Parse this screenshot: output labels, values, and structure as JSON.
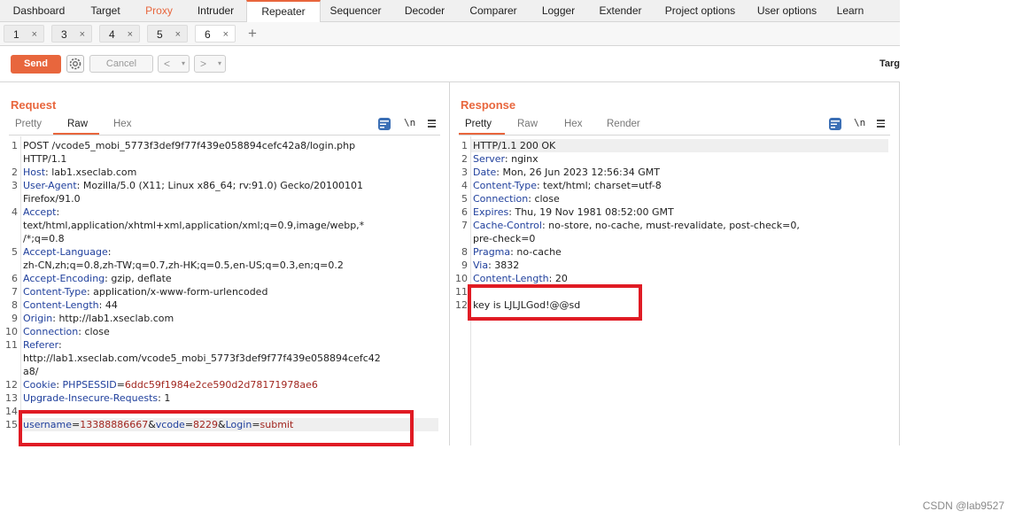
{
  "menu_tabs": [
    {
      "label": "Dashboard"
    },
    {
      "label": "Target"
    },
    {
      "label": "Proxy"
    },
    {
      "label": "Intruder"
    },
    {
      "label": "Repeater"
    },
    {
      "label": "Sequencer"
    },
    {
      "label": "Decoder"
    },
    {
      "label": "Comparer"
    },
    {
      "label": "Logger"
    },
    {
      "label": "Extender"
    },
    {
      "label": "Project options"
    },
    {
      "label": "User options"
    },
    {
      "label": "Learn"
    }
  ],
  "active_menu_tab": "Repeater",
  "repeater_tabs": [
    {
      "label": "1"
    },
    {
      "label": "3"
    },
    {
      "label": "4"
    },
    {
      "label": "5"
    },
    {
      "label": "6"
    }
  ],
  "active_repeater_tab": "6",
  "tab_close": "×",
  "add_tab": "+",
  "toolbar": {
    "send_label": "Send",
    "cancel_label": "Cancel",
    "back": "<",
    "forward": ">",
    "dropdown": "▾",
    "target_label": "Targ"
  },
  "colors": {
    "accent": "#e8663d",
    "keyword": "#1f3f9c",
    "value": "#a1261f",
    "annotation": "#e01b24",
    "selected": "#3b6fb5"
  },
  "request": {
    "title": "Request",
    "views": [
      "Pretty",
      "Raw",
      "Hex"
    ],
    "active_view": "Raw",
    "newline_toggle": "\\n",
    "lines": [
      {
        "n": "1",
        "segments": [
          {
            "t": "POST /vcode5_mobi_5773f3def9f77f439e058894cefc42a8/login.php",
            "c": "plain"
          }
        ]
      },
      {
        "n": "",
        "segments": [
          {
            "t": "HTTP/1.1",
            "c": "plain"
          }
        ]
      },
      {
        "n": "2",
        "segments": [
          {
            "t": "Host",
            "c": "k"
          },
          {
            "t": ": lab1.xseclab.com",
            "c": "plain"
          }
        ]
      },
      {
        "n": "3",
        "segments": [
          {
            "t": "User-Agent",
            "c": "k"
          },
          {
            "t": ": Mozilla/5.0 (X11; Linux x86_64; rv:91.0) Gecko/20100101",
            "c": "plain"
          }
        ]
      },
      {
        "n": "",
        "segments": [
          {
            "t": "Firefox/91.0",
            "c": "plain"
          }
        ]
      },
      {
        "n": "4",
        "segments": [
          {
            "t": "Accept",
            "c": "k"
          },
          {
            "t": ":",
            "c": "plain"
          }
        ]
      },
      {
        "n": "",
        "segments": [
          {
            "t": "text/html,application/xhtml+xml,application/xml;q=0.9,image/webp,*",
            "c": "plain"
          }
        ]
      },
      {
        "n": "",
        "segments": [
          {
            "t": "/*;q=0.8",
            "c": "plain"
          }
        ]
      },
      {
        "n": "5",
        "segments": [
          {
            "t": "Accept-Language",
            "c": "k"
          },
          {
            "t": ":",
            "c": "plain"
          }
        ]
      },
      {
        "n": "",
        "segments": [
          {
            "t": "zh-CN,zh;q=0.8,zh-TW;q=0.7,zh-HK;q=0.5,en-US;q=0.3,en;q=0.2",
            "c": "plain"
          }
        ]
      },
      {
        "n": "6",
        "segments": [
          {
            "t": "Accept-Encoding",
            "c": "k"
          },
          {
            "t": ": gzip, deflate",
            "c": "plain"
          }
        ]
      },
      {
        "n": "7",
        "segments": [
          {
            "t": "Content-Type",
            "c": "k"
          },
          {
            "t": ": application/x-www-form-urlencoded",
            "c": "plain"
          }
        ]
      },
      {
        "n": "8",
        "segments": [
          {
            "t": "Content-Length",
            "c": "k"
          },
          {
            "t": ": 44",
            "c": "plain"
          }
        ]
      },
      {
        "n": "9",
        "segments": [
          {
            "t": "Origin",
            "c": "k"
          },
          {
            "t": ": http://lab1.xseclab.com",
            "c": "plain"
          }
        ]
      },
      {
        "n": "10",
        "segments": [
          {
            "t": "Connection",
            "c": "k"
          },
          {
            "t": ": close",
            "c": "plain"
          }
        ]
      },
      {
        "n": "11",
        "segments": [
          {
            "t": "Referer",
            "c": "k"
          },
          {
            "t": ":",
            "c": "plain"
          }
        ]
      },
      {
        "n": "",
        "segments": [
          {
            "t": "http://lab1.xseclab.com/vcode5_mobi_5773f3def9f77f439e058894cefc42",
            "c": "plain"
          }
        ]
      },
      {
        "n": "",
        "segments": [
          {
            "t": "a8/",
            "c": "plain"
          }
        ]
      },
      {
        "n": "12",
        "segments": [
          {
            "t": "Cookie",
            "c": "k"
          },
          {
            "t": ": ",
            "c": "plain"
          },
          {
            "t": "PHPSESSID",
            "c": "k"
          },
          {
            "t": "=",
            "c": "plain"
          },
          {
            "t": "6ddc59f1984e2ce590d2d78171978ae6",
            "c": "v"
          }
        ]
      },
      {
        "n": "13",
        "segments": [
          {
            "t": "Upgrade-Insecure-Requests",
            "c": "k"
          },
          {
            "t": ": 1",
            "c": "plain"
          }
        ]
      },
      {
        "n": "14",
        "segments": []
      },
      {
        "n": "15",
        "segments": [
          {
            "t": "username",
            "c": "k"
          },
          {
            "t": "=",
            "c": "plain"
          },
          {
            "t": "13388886667",
            "c": "v"
          },
          {
            "t": "&",
            "c": "plain"
          },
          {
            "t": "vcode",
            "c": "k"
          },
          {
            "t": "=",
            "c": "plain"
          },
          {
            "t": "8229",
            "c": "v"
          },
          {
            "t": "&",
            "c": "plain"
          },
          {
            "t": "Login",
            "c": "k"
          },
          {
            "t": "=",
            "c": "plain"
          },
          {
            "t": "submit",
            "c": "v"
          }
        ],
        "highlight": true
      }
    ]
  },
  "response": {
    "title": "Response",
    "views": [
      "Pretty",
      "Raw",
      "Hex",
      "Render"
    ],
    "active_view": "Pretty",
    "newline_toggle": "\\n",
    "lines": [
      {
        "n": "1",
        "segments": [
          {
            "t": "HTTP/1.1 200 OK",
            "c": "plain"
          }
        ],
        "highlight": true
      },
      {
        "n": "2",
        "segments": [
          {
            "t": "Server",
            "c": "k"
          },
          {
            "t": ": nginx",
            "c": "plain"
          }
        ]
      },
      {
        "n": "3",
        "segments": [
          {
            "t": "Date",
            "c": "k"
          },
          {
            "t": ": Mon, 26 Jun 2023 12:56:34 GMT",
            "c": "plain"
          }
        ]
      },
      {
        "n": "4",
        "segments": [
          {
            "t": "Content-Type",
            "c": "k"
          },
          {
            "t": ": text/html; charset=utf-8",
            "c": "plain"
          }
        ]
      },
      {
        "n": "5",
        "segments": [
          {
            "t": "Connection",
            "c": "k"
          },
          {
            "t": ": close",
            "c": "plain"
          }
        ]
      },
      {
        "n": "6",
        "segments": [
          {
            "t": "Expires",
            "c": "k"
          },
          {
            "t": ": Thu, 19 Nov 1981 08:52:00 GMT",
            "c": "plain"
          }
        ]
      },
      {
        "n": "7",
        "segments": [
          {
            "t": "Cache-Control",
            "c": "k"
          },
          {
            "t": ": no-store, no-cache, must-revalidate, post-check=0,",
            "c": "plain"
          }
        ]
      },
      {
        "n": "",
        "segments": [
          {
            "t": "pre-check=0",
            "c": "plain"
          }
        ]
      },
      {
        "n": "8",
        "segments": [
          {
            "t": "Pragma",
            "c": "k"
          },
          {
            "t": ": no-cache",
            "c": "plain"
          }
        ]
      },
      {
        "n": "9",
        "segments": [
          {
            "t": "Via",
            "c": "k"
          },
          {
            "t": ": 3832",
            "c": "plain"
          }
        ]
      },
      {
        "n": "10",
        "segments": [
          {
            "t": "Content-Length",
            "c": "k"
          },
          {
            "t": ": 20",
            "c": "plain"
          }
        ]
      },
      {
        "n": "11",
        "segments": []
      },
      {
        "n": "12",
        "segments": [
          {
            "t": "key is LJLJLGod!@@sd",
            "c": "plain"
          }
        ]
      }
    ]
  },
  "watermark": "CSDN @lab9527"
}
